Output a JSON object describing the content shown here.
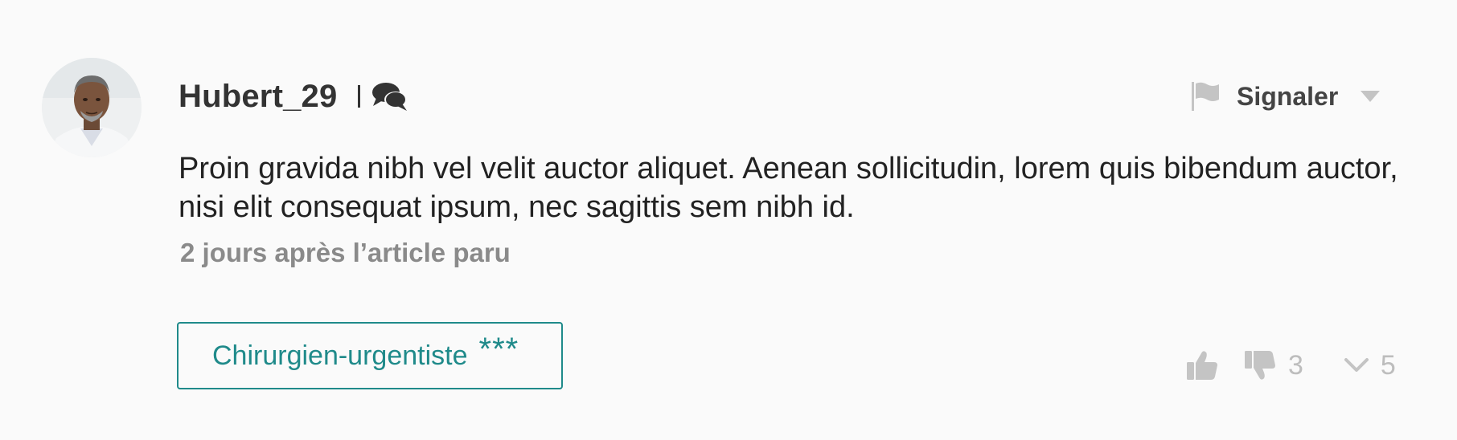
{
  "comment": {
    "author": "Hubert_29",
    "text": "Proin gravida nibh vel velit auctor aliquet. Aenean sollicitudin, lorem quis bibendum auctor, nisi elit consequat ipsum, nec sagittis sem nibh id.",
    "timestamp": "2 jours après l’article paru",
    "report_label": "Signaler",
    "profession": {
      "label": "Chirurgien-urgentiste",
      "stars": "***"
    },
    "dislike_count": "3",
    "replies_count": "5"
  },
  "icons": {
    "avatar": "user-avatar",
    "comments": "comments-icon",
    "flag": "flag-icon",
    "caret": "caret-down-icon",
    "like": "thumbs-up-icon",
    "dislike": "thumbs-down-icon",
    "expand": "chevron-down-icon"
  },
  "colors": {
    "background": "#fafafa",
    "accent": "#1f8a8a",
    "muted": "#bdbdbd",
    "text": "#222222",
    "timestamp": "#8a8a8a"
  }
}
